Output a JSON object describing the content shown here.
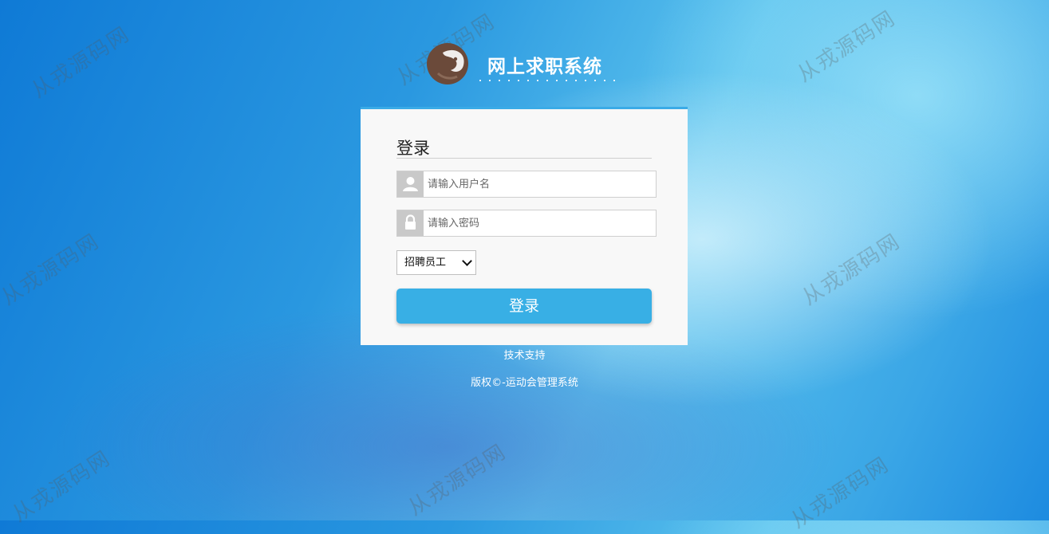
{
  "header": {
    "system_name": "网上求职系统"
  },
  "login": {
    "title": "登录",
    "username_placeholder": "请输入用户名",
    "password_placeholder": "请输入密码",
    "role_selected": "招聘员工",
    "submit_label": "登录"
  },
  "footer": {
    "support": "技术支持",
    "copyright": "版权©-运动会管理系统"
  },
  "watermark": "从戎源码网",
  "colors": {
    "accent": "#38afe5",
    "panel_bg": "#f8f8f8",
    "logo": "#6b4a3a"
  },
  "icons": [
    "logo-icon",
    "user-icon",
    "lock-icon",
    "chevron-down-icon"
  ]
}
